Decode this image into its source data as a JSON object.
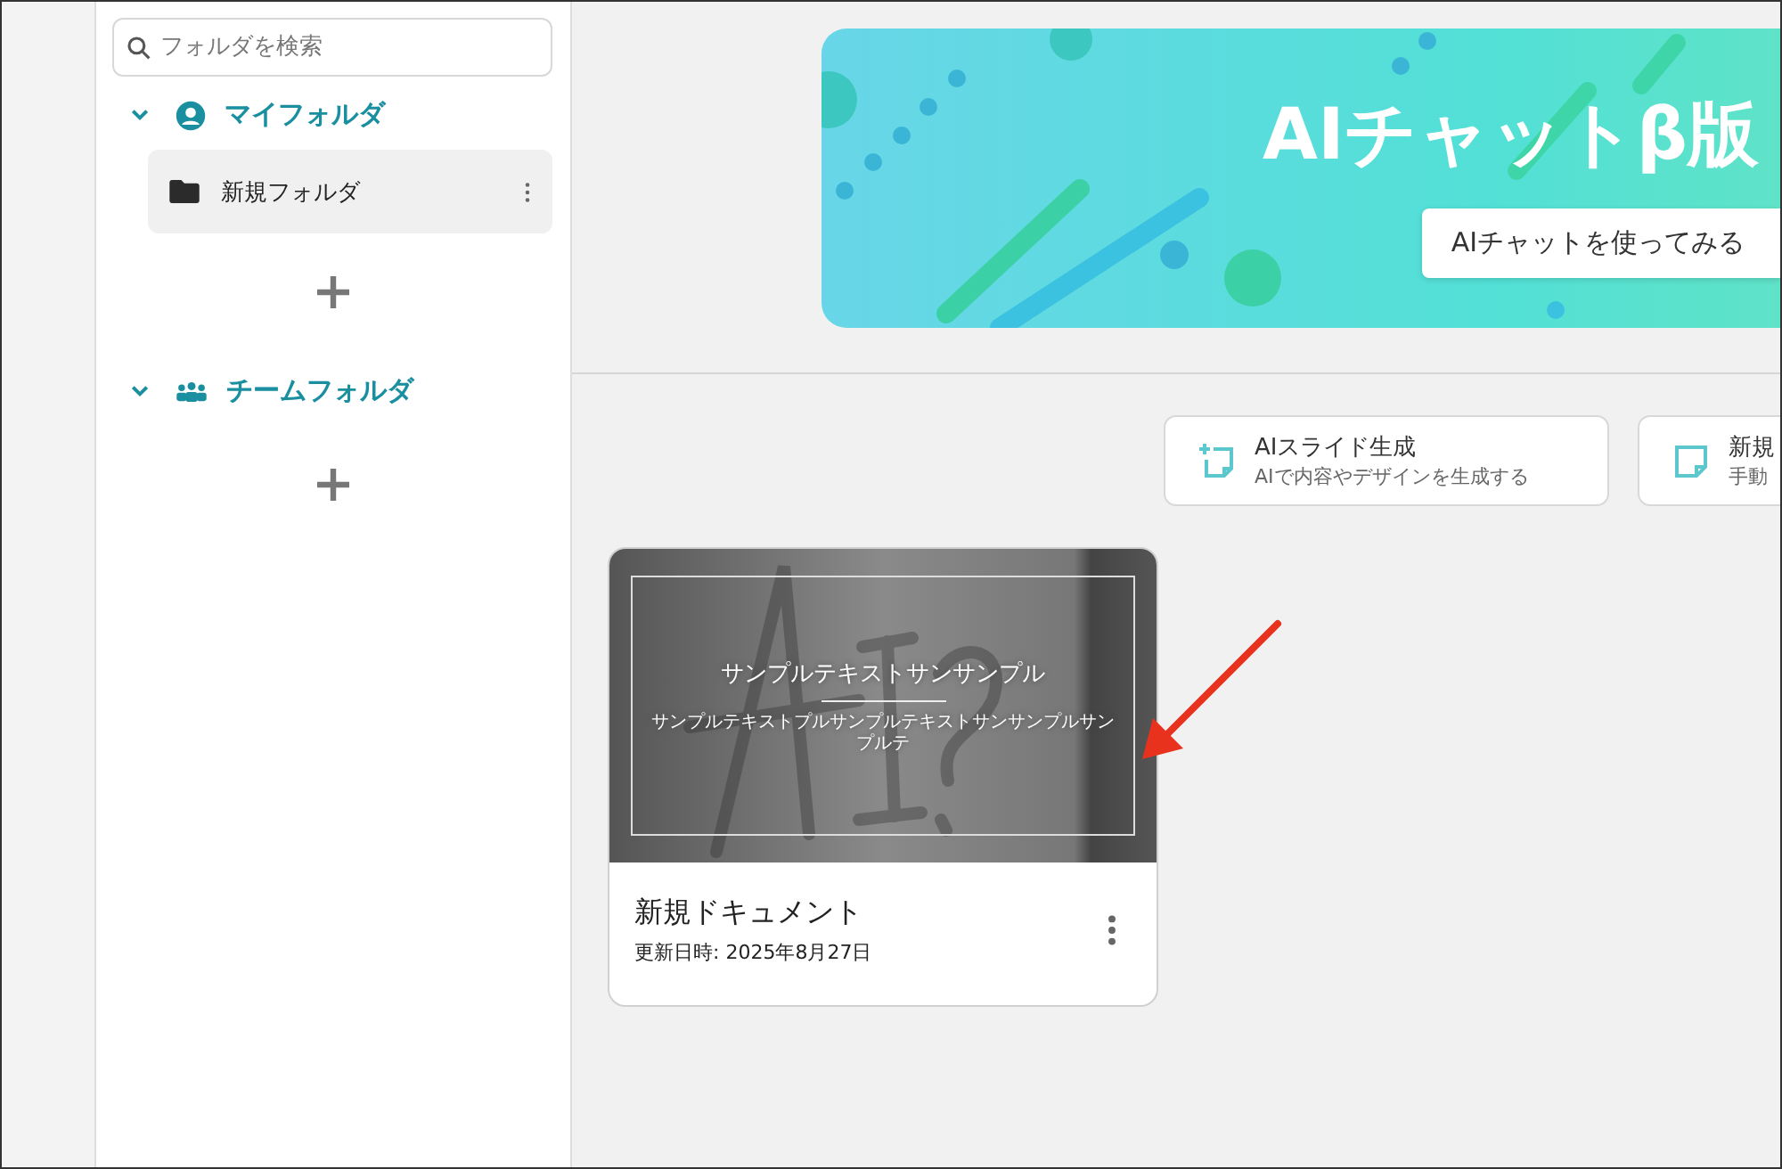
{
  "sidebar": {
    "search": {
      "placeholder": "フォルダを検索"
    },
    "sections": [
      {
        "title": "マイフォルダ",
        "kind": "personal",
        "expanded": true,
        "folders": [
          {
            "name": "新規フォルダ",
            "selected": true
          }
        ]
      },
      {
        "title": "チームフォルダ",
        "kind": "team",
        "expanded": true
      }
    ]
  },
  "banner": {
    "title": "AIチャットβ版",
    "button": "AIチャットを使ってみる"
  },
  "actions": [
    {
      "kind": "ai",
      "title": "AIスライド生成",
      "subtitle": "AIで内容やデザインを生成する"
    },
    {
      "kind": "blank",
      "title": "新規",
      "subtitle": "手動"
    }
  ],
  "documents": [
    {
      "title": "新規ドキュメント",
      "updated": "更新日時: 2025年8月27日",
      "thumbnail": {
        "heading": "サンプルテキストサンサンプル",
        "subheading": "サンプルテキストプルサンプルテキストサンサンプルサンプルテ"
      }
    }
  ]
}
